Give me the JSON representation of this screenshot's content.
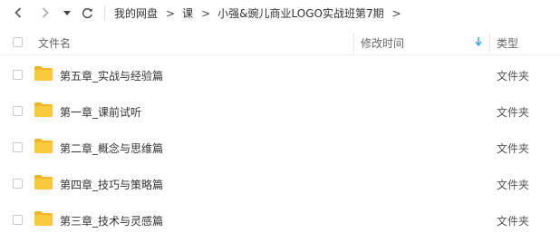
{
  "nav": {
    "back_icon": "chevron-left-icon",
    "forward_icon": "chevron-right-icon",
    "history_icon": "caret-down-icon",
    "refresh_icon": "refresh-icon"
  },
  "breadcrumb": [
    "我的网盘",
    "课",
    "小强&豌儿商业LOGO实战班第7期"
  ],
  "columns": {
    "name": "文件名",
    "modified": "修改时间",
    "type": "类型"
  },
  "sort": {
    "column": "modified",
    "direction": "descending",
    "color": "#2a9ee6"
  },
  "files": [
    {
      "name": "第五章_实战与经验篇",
      "type": "文件夹"
    },
    {
      "name": "第一章_课前试听",
      "type": "文件夹"
    },
    {
      "name": "第二章_概念与思维篇",
      "type": "文件夹"
    },
    {
      "name": "第四章_技巧与策略篇",
      "type": "文件夹"
    },
    {
      "name": "第三章_技术与灵感篇",
      "type": "文件夹"
    }
  ],
  "colors": {
    "folder": "#f8c93c",
    "folder_tab": "#f0b526"
  }
}
